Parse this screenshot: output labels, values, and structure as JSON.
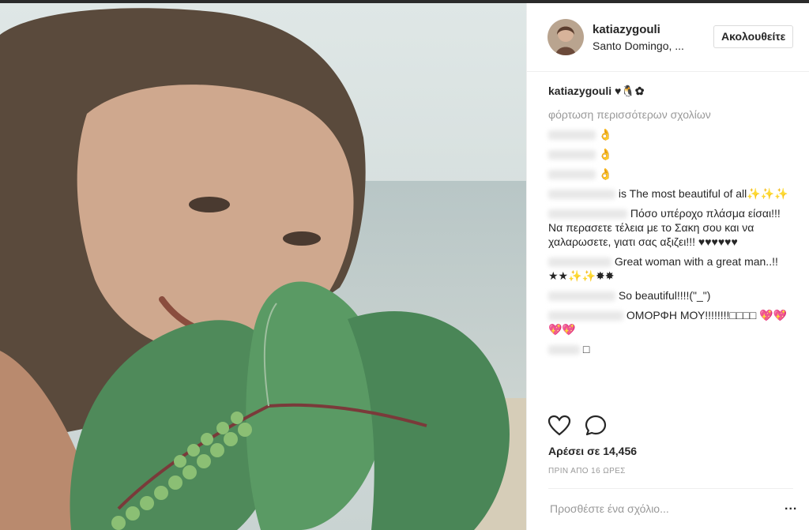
{
  "post": {
    "username": "katiazygouli",
    "location": "Santo Domingo, ...",
    "follow_label": "Ακολουθείτε",
    "caption_user": "katiazygouli",
    "caption_text": " ♥🐧✿",
    "load_more": "φόρτωση περισσότερων σχολίων",
    "comments": [
      {
        "text": "👌"
      },
      {
        "text": "👌"
      },
      {
        "text": "👌"
      },
      {
        "text": "is The most beautiful of all✨✨✨"
      },
      {
        "text": "Πόσο υπέροχο πλάσμα είσαι!!! Να περασετε τέλεια με το Σακη σου και να χαλαρωσετε, γιατι σας αξιζει!!! ♥♥♥♥♥♥"
      },
      {
        "text": "Great woman with a great man..!!★★✨✨✸✸"
      },
      {
        "text": "So beautiful!!!!(\"_\")"
      },
      {
        "text": "ΟΜΟΡΦΗ ΜΟΥ!!!!!!!!□□□□ 💖💖💖💖"
      },
      {
        "text": "□"
      }
    ],
    "likes": "Αρέσει σε 14,456",
    "time": "ΠΡΙΝ ΑΠΟ 16 ΩΡΕΣ",
    "comment_placeholder": "Προσθέστε ένα σχόλιο...",
    "more_label": "..."
  },
  "icons": {
    "like": "heart-icon",
    "comment": "comment-bubble-icon",
    "more": "more-options-icon"
  },
  "colors": {
    "text": "#262626",
    "muted": "#999999",
    "border": "#dbdbdb"
  }
}
